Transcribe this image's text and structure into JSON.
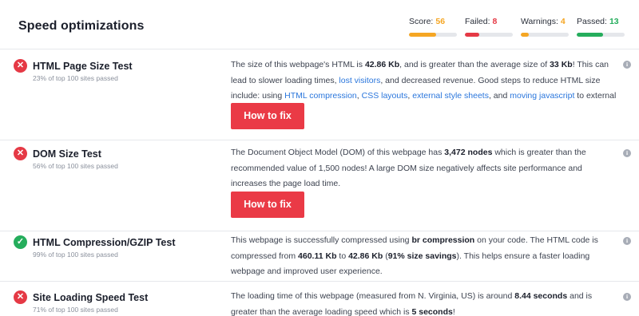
{
  "header": {
    "title": "Speed optimizations"
  },
  "stats": [
    {
      "label": "Score:",
      "value": "56",
      "color": "#f5a623",
      "fraction": 0.56
    },
    {
      "label": "Failed:",
      "value": "8",
      "color": "#e53945",
      "fraction": 0.3
    },
    {
      "label": "Warnings:",
      "value": "4",
      "color": "#f5a623",
      "fraction": 0.16
    },
    {
      "label": "Passed:",
      "value": "13",
      "color": "#25ad5c",
      "fraction": 0.55
    }
  ],
  "rows": [
    {
      "status": "fail",
      "status_glyph": "✕",
      "title": "HTML Page Size Test",
      "subtitle": "23% of top 100 sites passed",
      "desc": [
        {
          "t": "The size of this webpage's HTML is "
        },
        {
          "b": "42.86 Kb"
        },
        {
          "t": ", and is greater than the average size of "
        },
        {
          "b": "33 Kb"
        },
        {
          "t": "! This can lead to slower loading times, "
        },
        {
          "l": "lost visitors"
        },
        {
          "t": ", and decreased revenue. Good steps to reduce HTML size include: using "
        },
        {
          "l": "HTML compression"
        },
        {
          "t": ", "
        },
        {
          "l": "CSS layouts"
        },
        {
          "t": ", "
        },
        {
          "l": "external style sheets"
        },
        {
          "t": ", and "
        },
        {
          "l": "moving javascript"
        },
        {
          "t": " to external files."
        }
      ],
      "button": "How to fix"
    },
    {
      "status": "fail",
      "status_glyph": "✕",
      "title": "DOM Size Test",
      "subtitle": "56% of top 100 sites passed",
      "desc": [
        {
          "t": "The Document Object Model (DOM) of this webpage has "
        },
        {
          "b": "3,472 nodes"
        },
        {
          "t": " which is greater than the recommended value of 1,500 nodes! A large DOM size negatively affects site performance and increases the page load time."
        }
      ],
      "button": "How to fix"
    },
    {
      "status": "pass",
      "status_glyph": "✓",
      "title": "HTML Compression/GZIP Test",
      "subtitle": "99% of top 100 sites passed",
      "desc": [
        {
          "t": "This webpage is successfully compressed using "
        },
        {
          "b": "br compression"
        },
        {
          "t": " on your code. The HTML code is compressed from "
        },
        {
          "b": "460.11 Kb"
        },
        {
          "t": " to "
        },
        {
          "b": "42.86 Kb"
        },
        {
          "t": " ("
        },
        {
          "b": "91% size savings"
        },
        {
          "t": "). This helps ensure a faster loading webpage and improved user experience."
        }
      ]
    },
    {
      "status": "fail",
      "status_glyph": "✕",
      "title": "Site Loading Speed Test",
      "subtitle": "71% of top 100 sites passed",
      "desc": [
        {
          "t": "The loading time of this webpage (measured from N. Virginia, US) is around "
        },
        {
          "b": "8.44 seconds"
        },
        {
          "t": " and is greater than the average loading speed which is "
        },
        {
          "b": "5 seconds"
        },
        {
          "t": "!"
        }
      ]
    }
  ],
  "info_glyph": "i"
}
